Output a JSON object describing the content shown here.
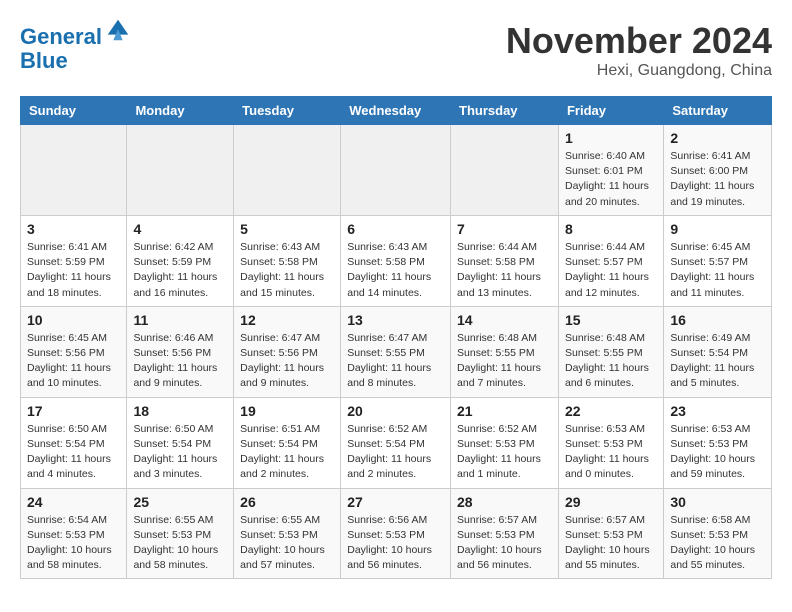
{
  "header": {
    "logo_line1": "General",
    "logo_line2": "Blue",
    "month_title": "November 2024",
    "subtitle": "Hexi, Guangdong, China"
  },
  "weekdays": [
    "Sunday",
    "Monday",
    "Tuesday",
    "Wednesday",
    "Thursday",
    "Friday",
    "Saturday"
  ],
  "weeks": [
    [
      {
        "day": "",
        "info": ""
      },
      {
        "day": "",
        "info": ""
      },
      {
        "day": "",
        "info": ""
      },
      {
        "day": "",
        "info": ""
      },
      {
        "day": "",
        "info": ""
      },
      {
        "day": "1",
        "info": "Sunrise: 6:40 AM\nSunset: 6:01 PM\nDaylight: 11 hours\nand 20 minutes."
      },
      {
        "day": "2",
        "info": "Sunrise: 6:41 AM\nSunset: 6:00 PM\nDaylight: 11 hours\nand 19 minutes."
      }
    ],
    [
      {
        "day": "3",
        "info": "Sunrise: 6:41 AM\nSunset: 5:59 PM\nDaylight: 11 hours\nand 18 minutes."
      },
      {
        "day": "4",
        "info": "Sunrise: 6:42 AM\nSunset: 5:59 PM\nDaylight: 11 hours\nand 16 minutes."
      },
      {
        "day": "5",
        "info": "Sunrise: 6:43 AM\nSunset: 5:58 PM\nDaylight: 11 hours\nand 15 minutes."
      },
      {
        "day": "6",
        "info": "Sunrise: 6:43 AM\nSunset: 5:58 PM\nDaylight: 11 hours\nand 14 minutes."
      },
      {
        "day": "7",
        "info": "Sunrise: 6:44 AM\nSunset: 5:58 PM\nDaylight: 11 hours\nand 13 minutes."
      },
      {
        "day": "8",
        "info": "Sunrise: 6:44 AM\nSunset: 5:57 PM\nDaylight: 11 hours\nand 12 minutes."
      },
      {
        "day": "9",
        "info": "Sunrise: 6:45 AM\nSunset: 5:57 PM\nDaylight: 11 hours\nand 11 minutes."
      }
    ],
    [
      {
        "day": "10",
        "info": "Sunrise: 6:45 AM\nSunset: 5:56 PM\nDaylight: 11 hours\nand 10 minutes."
      },
      {
        "day": "11",
        "info": "Sunrise: 6:46 AM\nSunset: 5:56 PM\nDaylight: 11 hours\nand 9 minutes."
      },
      {
        "day": "12",
        "info": "Sunrise: 6:47 AM\nSunset: 5:56 PM\nDaylight: 11 hours\nand 9 minutes."
      },
      {
        "day": "13",
        "info": "Sunrise: 6:47 AM\nSunset: 5:55 PM\nDaylight: 11 hours\nand 8 minutes."
      },
      {
        "day": "14",
        "info": "Sunrise: 6:48 AM\nSunset: 5:55 PM\nDaylight: 11 hours\nand 7 minutes."
      },
      {
        "day": "15",
        "info": "Sunrise: 6:48 AM\nSunset: 5:55 PM\nDaylight: 11 hours\nand 6 minutes."
      },
      {
        "day": "16",
        "info": "Sunrise: 6:49 AM\nSunset: 5:54 PM\nDaylight: 11 hours\nand 5 minutes."
      }
    ],
    [
      {
        "day": "17",
        "info": "Sunrise: 6:50 AM\nSunset: 5:54 PM\nDaylight: 11 hours\nand 4 minutes."
      },
      {
        "day": "18",
        "info": "Sunrise: 6:50 AM\nSunset: 5:54 PM\nDaylight: 11 hours\nand 3 minutes."
      },
      {
        "day": "19",
        "info": "Sunrise: 6:51 AM\nSunset: 5:54 PM\nDaylight: 11 hours\nand 2 minutes."
      },
      {
        "day": "20",
        "info": "Sunrise: 6:52 AM\nSunset: 5:54 PM\nDaylight: 11 hours\nand 2 minutes."
      },
      {
        "day": "21",
        "info": "Sunrise: 6:52 AM\nSunset: 5:53 PM\nDaylight: 11 hours\nand 1 minute."
      },
      {
        "day": "22",
        "info": "Sunrise: 6:53 AM\nSunset: 5:53 PM\nDaylight: 11 hours\nand 0 minutes."
      },
      {
        "day": "23",
        "info": "Sunrise: 6:53 AM\nSunset: 5:53 PM\nDaylight: 10 hours\nand 59 minutes."
      }
    ],
    [
      {
        "day": "24",
        "info": "Sunrise: 6:54 AM\nSunset: 5:53 PM\nDaylight: 10 hours\nand 58 minutes."
      },
      {
        "day": "25",
        "info": "Sunrise: 6:55 AM\nSunset: 5:53 PM\nDaylight: 10 hours\nand 58 minutes."
      },
      {
        "day": "26",
        "info": "Sunrise: 6:55 AM\nSunset: 5:53 PM\nDaylight: 10 hours\nand 57 minutes."
      },
      {
        "day": "27",
        "info": "Sunrise: 6:56 AM\nSunset: 5:53 PM\nDaylight: 10 hours\nand 56 minutes."
      },
      {
        "day": "28",
        "info": "Sunrise: 6:57 AM\nSunset: 5:53 PM\nDaylight: 10 hours\nand 56 minutes."
      },
      {
        "day": "29",
        "info": "Sunrise: 6:57 AM\nSunset: 5:53 PM\nDaylight: 10 hours\nand 55 minutes."
      },
      {
        "day": "30",
        "info": "Sunrise: 6:58 AM\nSunset: 5:53 PM\nDaylight: 10 hours\nand 55 minutes."
      }
    ]
  ]
}
